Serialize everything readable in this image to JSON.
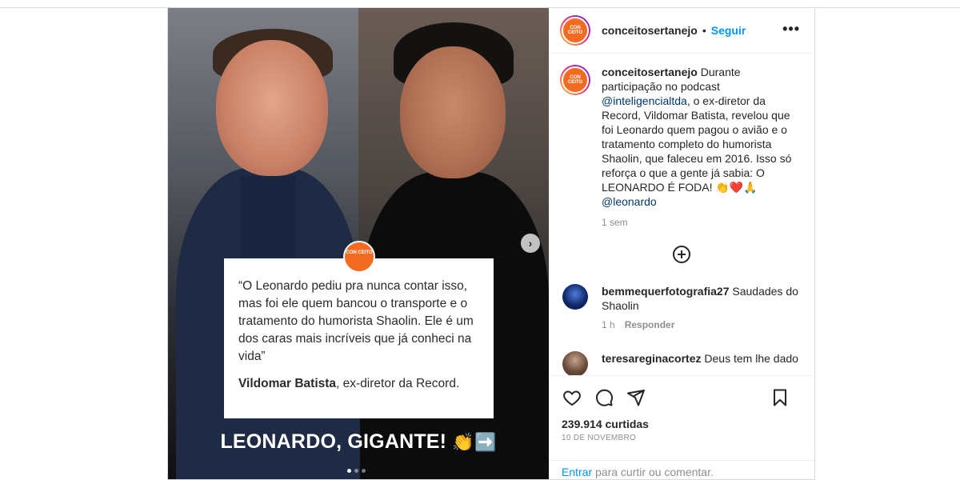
{
  "account": {
    "username": "conceitosertanejo",
    "separator": "•",
    "follow_label": "Seguir",
    "more_label": "•••",
    "logo_text": "CON CEITO"
  },
  "media": {
    "next_label": "›",
    "quote": "“O Leonardo pediu pra nunca contar isso, mas foi ele quem bancou o transporte e o tratamento do humorista Shaolin. Ele é um dos caras mais incríveis que já conheci na vida”",
    "quote_author_name": "Vildomar Batista",
    "quote_author_role": ", ex-diretor da Record.",
    "headline": "LEONARDO, GIGANTE!",
    "headline_emoji": "👏➡️",
    "slide_count": 3,
    "active_slide": 1
  },
  "caption": {
    "username": "conceitosertanejo",
    "text_before": " Durante participação no podcast ",
    "mention1": "@inteligencialtda",
    "text_middle": ", o ex-diretor da Record, Vildomar Batista, revelou que foi Leonardo quem pagou o avião e o tratamento completo do humorista Shaolin, que faleceu em 2016. Isso só reforça o que a gente já sabia: O LEONARDO É FODA! 👏❤️🙏 ",
    "mention2": "@leonardo",
    "time": "1 sem"
  },
  "comments": [
    {
      "username": "bemmequerfotografia27",
      "text": " Saudades do Shaolin",
      "time": "1 h",
      "reply_label": "Responder"
    },
    {
      "username": "teresareginacortez",
      "text": " Deus tem lhe dado",
      "time": "",
      "reply_label": ""
    }
  ],
  "actions": {
    "icons": [
      "heart-icon",
      "comment-icon",
      "share-icon",
      "bookmark-icon"
    ],
    "likes": "239.914 curtidas",
    "date": "10 DE NOVEMBRO"
  },
  "login": {
    "link_label": "Entrar",
    "text": " para curtir ou comentar."
  },
  "colors": {
    "link_blue": "#0095f6",
    "mention_blue": "#00376b",
    "brand_orange": "#f26b21"
  }
}
